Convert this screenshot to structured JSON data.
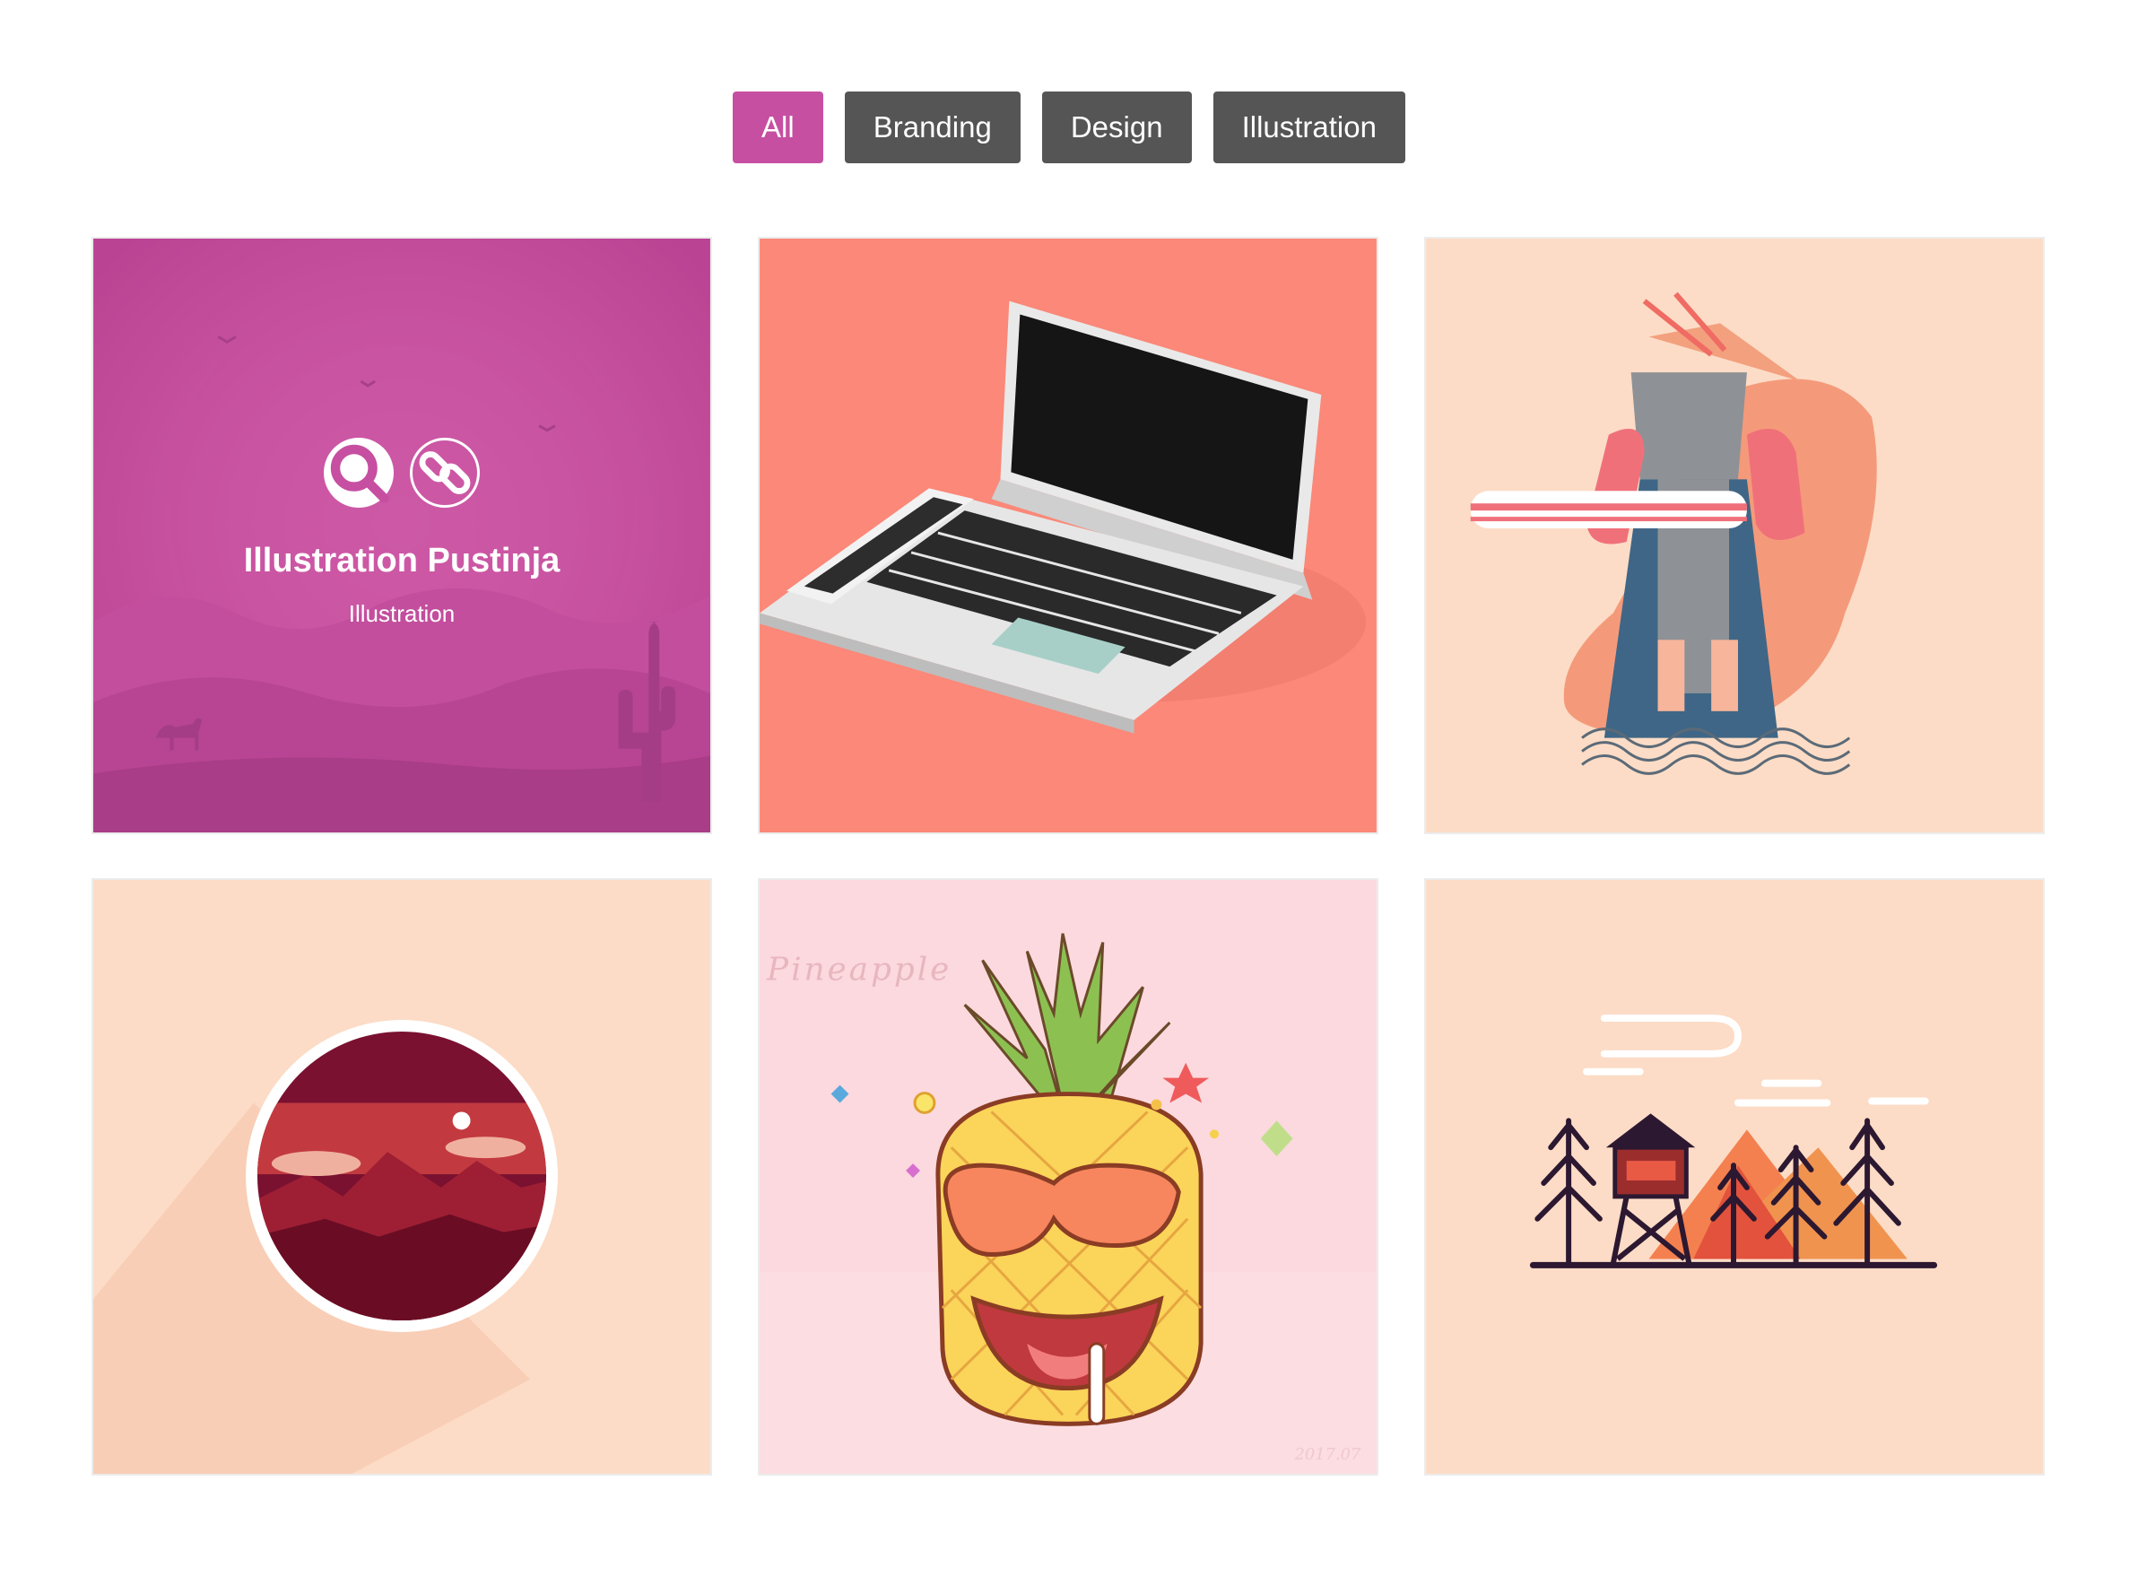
{
  "filters": [
    {
      "label": "All",
      "active": true
    },
    {
      "label": "Branding",
      "active": false
    },
    {
      "label": "Design",
      "active": false
    },
    {
      "label": "Illustration",
      "active": false
    }
  ],
  "portfolio": {
    "items": [
      {
        "title": "Illustration Pustinja",
        "category": "Illustration",
        "hovered": true,
        "icons": [
          "search-icon",
          "link-icon"
        ]
      },
      {
        "subject": "laptop"
      },
      {
        "subject": "samurai"
      },
      {
        "subject": "red-landscape-badge"
      },
      {
        "subject": "pineapple",
        "text": "Pineapple",
        "date_fragment": "2017.07"
      },
      {
        "subject": "fire-tower-forest"
      }
    ]
  },
  "colors": {
    "accent": "#c64fa1",
    "button": "#555555",
    "tile_peach": "#fcdcc6",
    "tile_coral": "#fb8878",
    "tile_pink": "#fbd9de"
  }
}
